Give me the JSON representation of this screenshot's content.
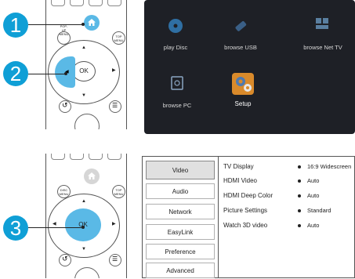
{
  "steps": {
    "one": "1",
    "two": "2",
    "three": "3"
  },
  "remote": {
    "popup_menu_label": "POP-UP MENU",
    "disc_menu_label": "DISC MENU",
    "top_menu_label": "TOP MENU",
    "ok_label": "OK",
    "accent": "#5ab9e6"
  },
  "home_menu": {
    "items": [
      {
        "label": "play Disc",
        "icon": "disc-icon"
      },
      {
        "label": "browse USB",
        "icon": "usb-icon"
      },
      {
        "label": "browse Net TV",
        "icon": "net-tv-icon"
      },
      {
        "label": "browse PC",
        "icon": "pc-icon"
      },
      {
        "label": "Setup",
        "icon": "setup-icon"
      }
    ]
  },
  "settings": {
    "categories": [
      "Video",
      "Audio",
      "Network",
      "EasyLink",
      "Preference",
      "Advanced"
    ],
    "active_category": "Video",
    "options": [
      {
        "name": "TV Display",
        "value": "16:9 Widescreen"
      },
      {
        "name": "HDMI Video",
        "value": "Auto"
      },
      {
        "name": "HDMI Deep Color",
        "value": "Auto"
      },
      {
        "name": "Picture Settings",
        "value": "Standard"
      },
      {
        "name": "Watch 3D video",
        "value": "Auto"
      }
    ]
  }
}
